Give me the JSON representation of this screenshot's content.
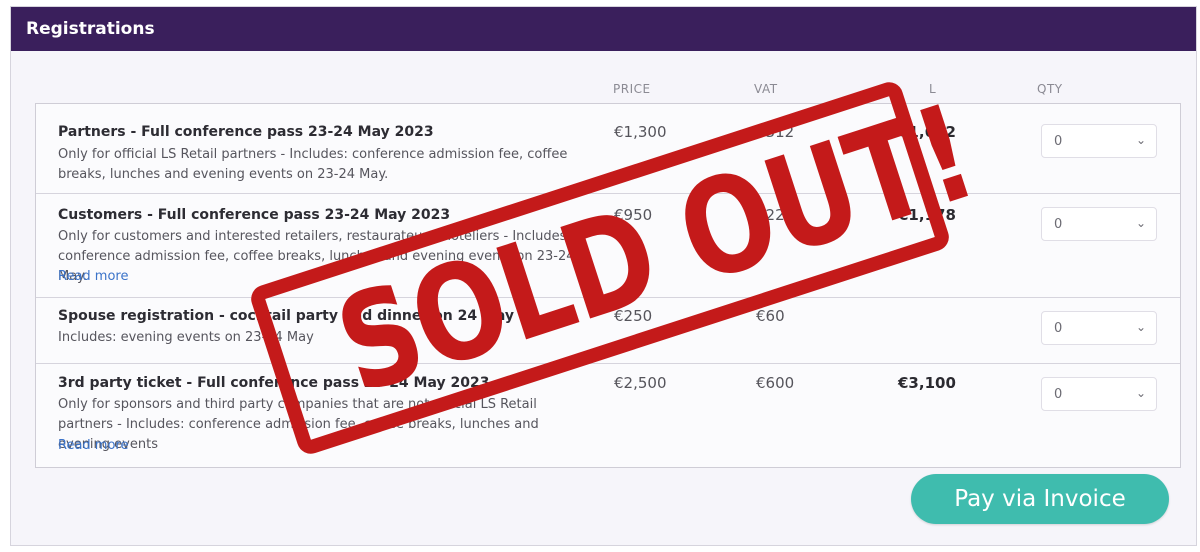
{
  "panel": {
    "title": "Registrations"
  },
  "columns": {
    "price": "PRICE",
    "vat": "VAT",
    "total": "L",
    "qty": "QTY"
  },
  "rows": [
    {
      "title": "Partners - Full conference pass 23-24 May 2023",
      "desc": "Only for official LS Retail partners - Includes: conference admission fee, coffee breaks, lunches and evening events on 23-24 May.",
      "link": "",
      "price": "€1,300",
      "vat": "€312",
      "total": "€1,612",
      "qty": "0"
    },
    {
      "title": "Customers - Full conference pass 23-24 May 2023",
      "desc": "Only for customers and interested retailers, restaurateurs, hoteliers - Includes: conference admission fee, coffee breaks, lunches and evening events on 23-24 May.",
      "link": "Read more",
      "price": "€950",
      "vat": "€228",
      "total": "€1,178",
      "qty": "0"
    },
    {
      "title": "Spouse registration - cocktail party and dinner on 24 May",
      "desc": "Includes: evening events on 23-24 May",
      "link": "",
      "price": "€250",
      "vat": "€60",
      "total": "",
      "qty": "0"
    },
    {
      "title": "3rd party ticket - Full conference pass 23-24 May 2023",
      "desc": "Only for sponsors and third party companies that are not official LS Retail partners - Includes: conference admission fee, coffee breaks, lunches and evening events",
      "link": "Read more",
      "price": "€2,500",
      "vat": "€600",
      "total": "€3,100",
      "qty": "0"
    }
  ],
  "pay_button": "Pay via Invoice",
  "stamp": {
    "text": "SOLD OUT!",
    "color": "#c41a1a"
  },
  "colors": {
    "header": "#3a1f5c",
    "button": "#3fbcae",
    "link": "#3b73c9"
  },
  "icons": {
    "qty_chevron": "chevron-down-icon"
  }
}
